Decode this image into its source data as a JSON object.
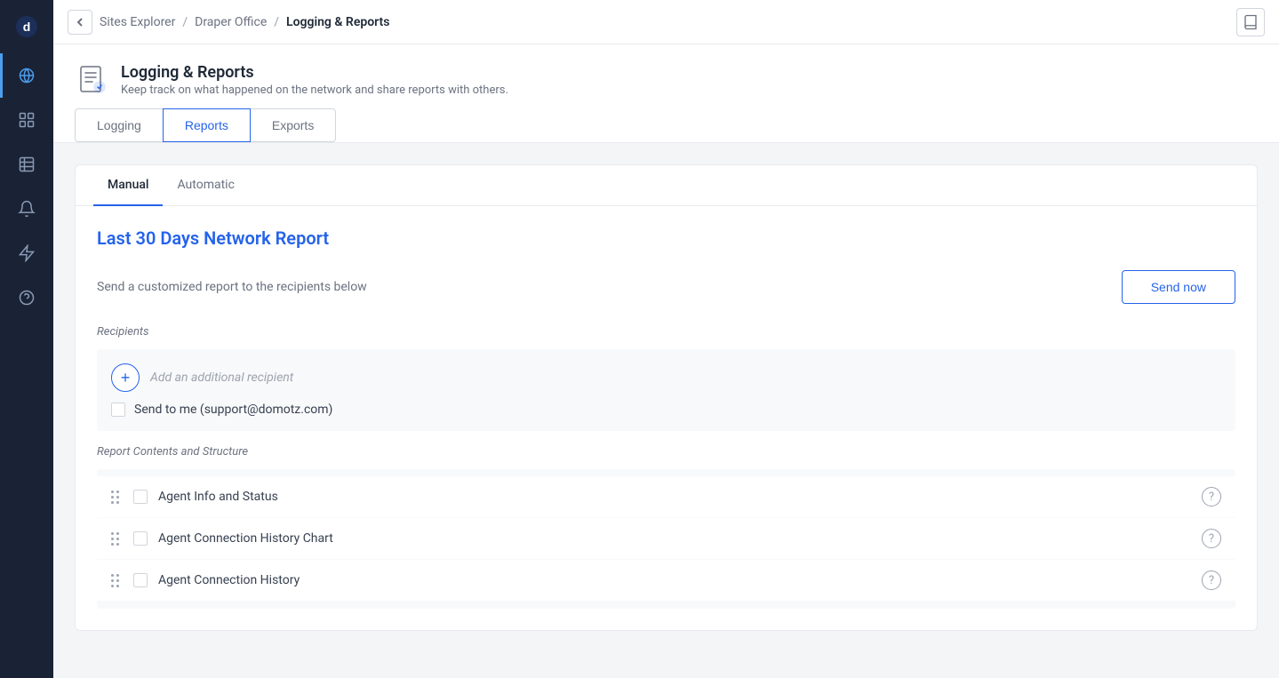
{
  "sidebar": {
    "logo": "d",
    "items": [
      {
        "id": "globe",
        "icon": "globe",
        "active": true
      },
      {
        "id": "grid",
        "icon": "grid",
        "active": false
      },
      {
        "id": "table",
        "icon": "table",
        "active": false
      },
      {
        "id": "bell",
        "icon": "bell",
        "active": false
      },
      {
        "id": "lightning",
        "icon": "lightning",
        "active": false
      },
      {
        "id": "question",
        "icon": "question",
        "active": false
      }
    ]
  },
  "topbar": {
    "back_label": "←",
    "breadcrumb": {
      "part1": "Sites Explorer",
      "sep1": "/",
      "part2": "Draper Office",
      "sep2": "/",
      "current": "Logging & Reports"
    },
    "book_icon": "📖"
  },
  "page_header": {
    "title": "Logging & Reports",
    "description": "Keep track on what happened on the network and share reports with others.",
    "tabs": [
      {
        "id": "logging",
        "label": "Logging",
        "active": false
      },
      {
        "id": "reports",
        "label": "Reports",
        "active": true
      },
      {
        "id": "exports",
        "label": "Exports",
        "active": false
      }
    ]
  },
  "report": {
    "sub_tabs": [
      {
        "id": "manual",
        "label": "Manual",
        "active": true
      },
      {
        "id": "automatic",
        "label": "Automatic",
        "active": false
      }
    ],
    "title": "Last 30 Days Network Report",
    "send_description": "Send a customized report to the recipients below",
    "send_now_label": "Send now",
    "recipients_label": "Recipients",
    "add_recipient_placeholder": "Add an additional recipient",
    "send_to_me_label": "Send to me (support@domotz.com)",
    "contents_label": "Report Contents and Structure",
    "contents_items": [
      {
        "id": "agent-info",
        "label": "Agent Info and Status"
      },
      {
        "id": "agent-connection-chart",
        "label": "Agent Connection History Chart"
      },
      {
        "id": "agent-connection-history",
        "label": "Agent Connection History"
      }
    ]
  }
}
